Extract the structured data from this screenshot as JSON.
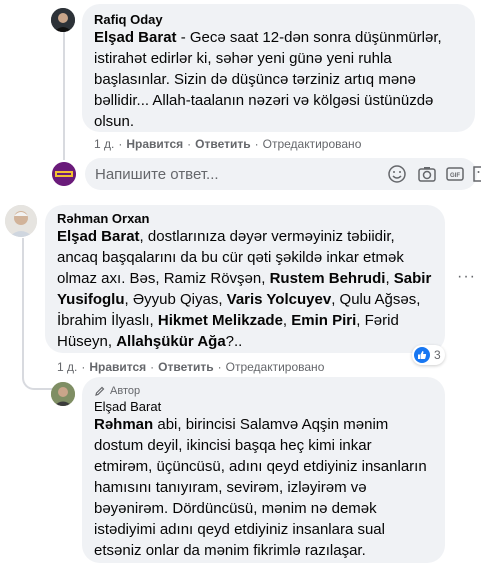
{
  "comments": [
    {
      "author": "Rafiq Oday",
      "text_parts": [
        {
          "bold": true,
          "text": "Elşad Barat"
        },
        {
          "bold": false,
          "text": " - Gecə saat 12-dən sonra düşünmürlər, istirahət edirlər ki, səhər yeni günə yeni ruhla başlasınlar. Sizin də düşüncə tərziniz artıq mənə bəllidir... Allah-taalanın nəzəri və kölgəsi üstünüzdə olsun."
        }
      ],
      "time": "1 д.",
      "like": "Нравится",
      "reply": "Ответить",
      "edited": "Отредактировано"
    },
    {
      "author": "Rəhman Orxan",
      "text_parts": [
        {
          "bold": true,
          "text": "Elşad Barat"
        },
        {
          "bold": false,
          "text": ", dostlarınıza dəyər verməyiniz təbiidir, ancaq başqalarını da bu cür qəti şəkildə inkar etmək olmaz axı. Bəs, Ramiz Rövşən, "
        },
        {
          "bold": true,
          "text": "Rustem Behrudi"
        },
        {
          "bold": false,
          "text": ", "
        },
        {
          "bold": true,
          "text": "Sabir Yusifoglu"
        },
        {
          "bold": false,
          "text": ", Əyyub Qiyas, "
        },
        {
          "bold": true,
          "text": "Varis Yolcuyev"
        },
        {
          "bold": false,
          "text": ", Qulu Ağsəs, İbrahim İlyaslı, "
        },
        {
          "bold": true,
          "text": "Hikmet Melikzade"
        },
        {
          "bold": false,
          "text": ", "
        },
        {
          "bold": true,
          "text": "Emin Piri"
        },
        {
          "bold": false,
          "text": ", Fərid Hüseyn, "
        },
        {
          "bold": true,
          "text": "Allahşükür Ağa"
        },
        {
          "bold": false,
          "text": "?.."
        }
      ],
      "time": "1 д.",
      "like": "Нравится",
      "reply": "Ответить",
      "edited": "Отредактировано",
      "reaction_count": "3"
    },
    {
      "badge": "Автор",
      "author": "Elşad Barat",
      "text_parts": [
        {
          "bold": true,
          "text": "Rəhman"
        },
        {
          "bold": false,
          "text": " abi, birincisi Salamvə Aqşin mənim dostum deyil, ikincisi başqa heç kimi inkar etmirəm, üçüncüsü, adını qeyd etdiyiniz insanların hamısını tanıyıram, sevirəm, izləyirəm və bəyənirəm. Dördüncüsü, mənim nə demək istədiyimi adını qeyd etdiyiniz insanlara sual etsəniz onlar da mənim fikrimlə razılaşar."
        }
      ]
    }
  ],
  "reply_box": {
    "placeholder": "Напишите ответ..."
  },
  "colors": {
    "bubble": "#f0f2f5",
    "meta": "#65676b",
    "like": "#1877f2"
  }
}
